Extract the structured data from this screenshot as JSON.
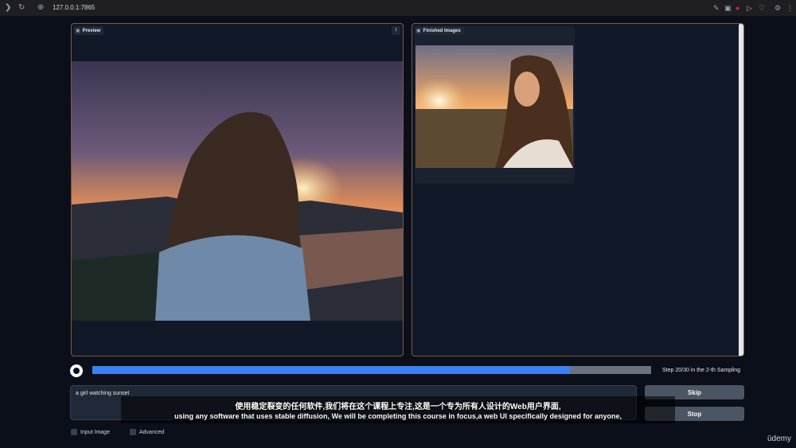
{
  "browser": {
    "url": "127.0.0.1:7865",
    "icons": [
      "back-icon",
      "reload-icon",
      "site-info-icon",
      "edit-icon",
      "camera-icon",
      "record-icon",
      "send-icon",
      "heart-icon",
      "extension-icon",
      "settings-icon"
    ]
  },
  "preview": {
    "label": "Preview",
    "download_icon": "download-icon"
  },
  "gallery": {
    "label": "Finished Images"
  },
  "progress": {
    "fraction": 0.854,
    "status": "Step 20/30 in the 2-th Sampling"
  },
  "prompt": {
    "value": "a girl watching sunset"
  },
  "buttons": {
    "skip": "Skip",
    "stop": "Stop"
  },
  "options": {
    "input_image": "Input Image",
    "advanced": "Advanced"
  },
  "subtitles": {
    "zh": "使用稳定裂变的任何软件,我们将在这个课程上专注,这是一个专为所有人设计的Web用户界面,",
    "en": "using any software that uses stable diffusion, We will be completing this course in focus,a web UI specifically designed for anyone,"
  },
  "brand": "ūdemy",
  "colors": {
    "background": "#0b0f19",
    "panel_border": "#7c5a45",
    "progress_fill": "#3b82f6",
    "button": "#4b5563"
  }
}
